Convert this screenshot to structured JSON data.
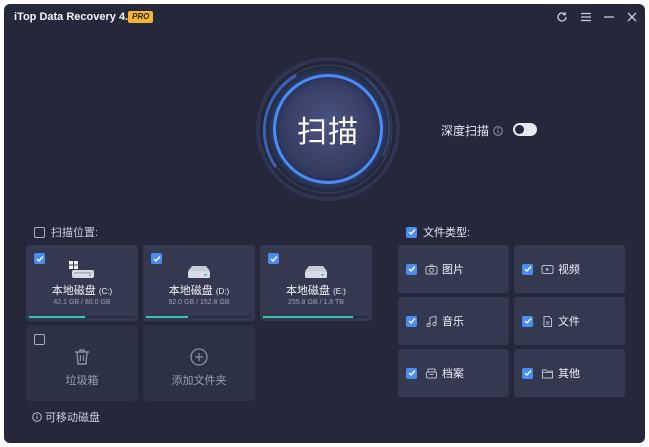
{
  "app": {
    "title": "iTop Data Recovery 4.4",
    "badge": "PRO"
  },
  "titlebar_buttons": [
    "refresh-icon",
    "menu-icon",
    "minimize-icon",
    "close-icon"
  ],
  "scan": {
    "label": "扫描"
  },
  "deep_scan": {
    "label": "深度扫描",
    "enabled": false
  },
  "locations": {
    "header": "扫描位置:",
    "checked": false,
    "drives": [
      {
        "name": "本地磁盘",
        "letter": "(C:)",
        "size": "42.1 GB / 80.0 GB",
        "used_fraction": 0.53,
        "checked": true
      },
      {
        "name": "本地磁盘",
        "letter": "(D:)",
        "size": "92.0 GB / 152.8 GB",
        "used_fraction": 0.4,
        "checked": true
      },
      {
        "name": "本地磁盘",
        "letter": "(E:)",
        "size": "255.8 GB / 1.8 TB",
        "used_fraction": 0.85,
        "checked": true
      }
    ],
    "recycle_bin": {
      "label": "垃圾箱",
      "checked": false
    },
    "add_folder": {
      "label": "添加文件夹"
    },
    "removable": {
      "label": "可移动磁盘"
    }
  },
  "file_types": {
    "header": "文件类型:",
    "checked": true,
    "items": [
      {
        "label": "图片",
        "icon": "camera-icon",
        "checked": true
      },
      {
        "label": "视频",
        "icon": "video-icon",
        "checked": true
      },
      {
        "label": "音乐",
        "icon": "music-icon",
        "checked": true
      },
      {
        "label": "文件",
        "icon": "document-icon",
        "checked": true
      },
      {
        "label": "档案",
        "icon": "archive-icon",
        "checked": true
      },
      {
        "label": "其他",
        "icon": "folder-icon",
        "checked": true
      }
    ]
  },
  "colors": {
    "background": "#25283a",
    "card": "#35394f",
    "accent": "#4a8cf5",
    "bar": "#39c6a8",
    "badge": "#f5b52a"
  }
}
